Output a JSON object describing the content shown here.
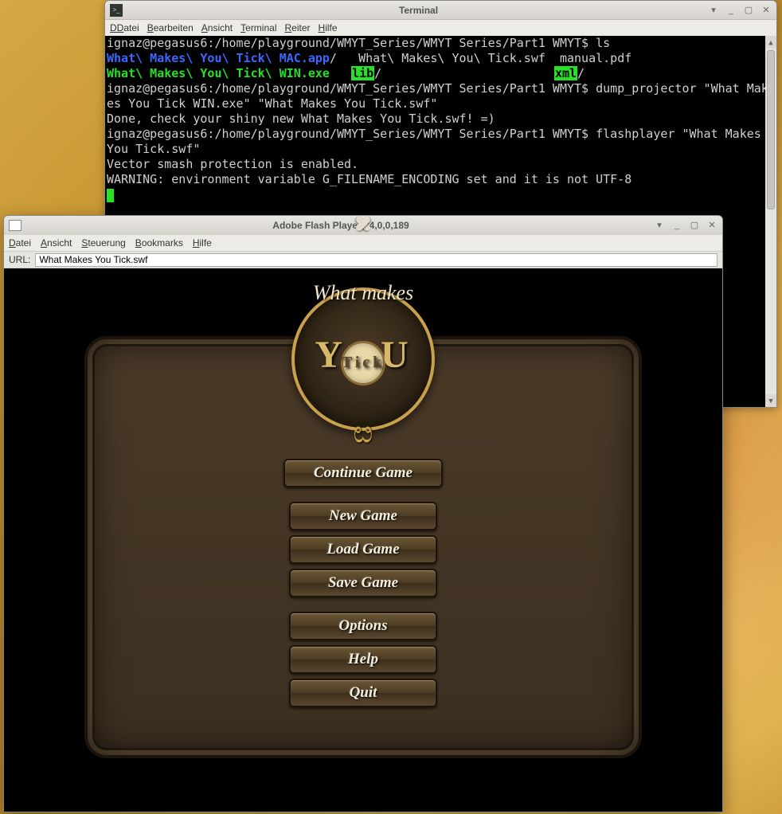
{
  "terminal": {
    "title": "Terminal",
    "menu": [
      "Datei",
      "Bearbeiten",
      "Ansicht",
      "Terminal",
      "Reiter",
      "Hilfe"
    ],
    "prompt_user": "ignaz@pegasus6",
    "prompt_path": "/home/playground/WMYT_Series/WMYT Series/Part1 WMYT",
    "lines": {
      "l1_user": "ignaz@pegasus6:/home/playground/WMYT_Series/WMYT Series/Part1 WMYT$ ",
      "l1_cmd": "ls",
      "l2_blue": "What\\ Makes\\ You\\ Tick\\ MAC.app",
      "l2_plain": "/   What\\ Makes\\ You\\ Tick.swf  manual.pdf",
      "l3_green": "What\\ Makes\\ You\\ Tick\\ WIN.exe",
      "l3_lib": "lib",
      "l3_xml": "xml",
      "l4_user": "ignaz@pegasus6:/home/playground/WMYT_Series/WMYT Series/Part1 WMYT$ ",
      "l4_cmd": "dump_projector \"What Makes You Tick WIN.exe\" \"What Makes You Tick.swf\"",
      "l5": "Done, check your shiny new What Makes You Tick.swf! =)",
      "l6_user": "ignaz@pegasus6:/home/playground/WMYT_Series/WMYT Series/Part1 WMYT$ ",
      "l6_cmd": "flashplayer \"What Makes You Tick.swf\"",
      "l7": "Vector smash protection is enabled.",
      "l8": "WARNING: environment variable G_FILENAME_ENCODING set and it is not UTF-8"
    }
  },
  "flash": {
    "title": "Adobe Flash Player 24,0,0,189",
    "menu": [
      "Datei",
      "Ansicht",
      "Steuerung",
      "Bookmarks",
      "Hilfe"
    ],
    "url_label": "URL:",
    "url_value": "What Makes You Tick.swf"
  },
  "game": {
    "logo_top": "What makes",
    "logo_you": "YOU",
    "logo_tick": "Tick",
    "buttons": {
      "continue": "Continue Game",
      "new": "New Game",
      "load": "Load Game",
      "save": "Save Game",
      "options": "Options",
      "help": "Help",
      "quit": "Quit"
    }
  }
}
